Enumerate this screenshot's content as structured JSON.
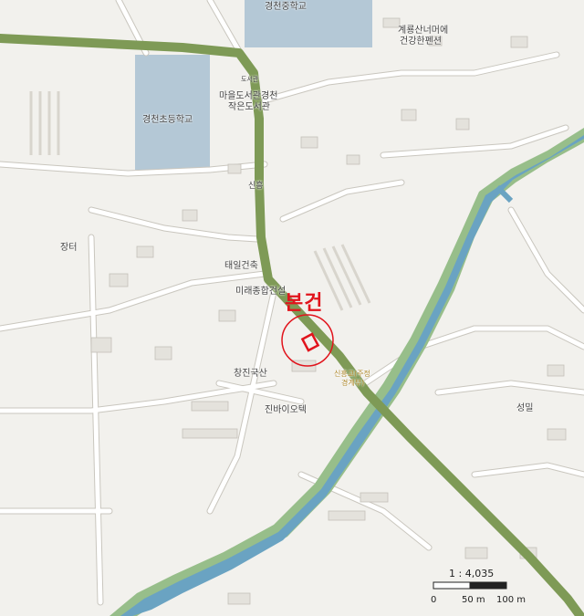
{
  "colors": {
    "background": "#f2f1ed",
    "river": "#6aa3c2",
    "river_bank": "#97be8a",
    "highway": "#7e9a56",
    "school_area": "#b4c8d6",
    "minor_road": "#ffffff",
    "road_outline": "#c9c6be",
    "marker": "#e1141c"
  },
  "labels": {
    "middle_school": "경천중학교",
    "elementary_school": "경천초등학교",
    "library_line1": "마을도서관경천",
    "library_line2": "작은도서관",
    "library_tag": "도서관",
    "pension_line1": "계룡산너머에",
    "pension_line2": "건강한펜션",
    "sinheung": "신흥",
    "jangteo": "장터",
    "taeil": "태일건축",
    "mirae": "미래종합건설",
    "changjin": "창진국산",
    "jinbio": "진바이오텍",
    "seongmil": "성밀",
    "bridge_line1": "신흥교(주정",
    "bridge_line2": "경계부)",
    "marker_label": "본건"
  },
  "marker": {
    "icon": "property-marker-icon",
    "label": "본건"
  },
  "scale_bar": {
    "ratio": "1 : 4,035",
    "ticks": [
      "0",
      "50 m",
      "100 m"
    ]
  }
}
